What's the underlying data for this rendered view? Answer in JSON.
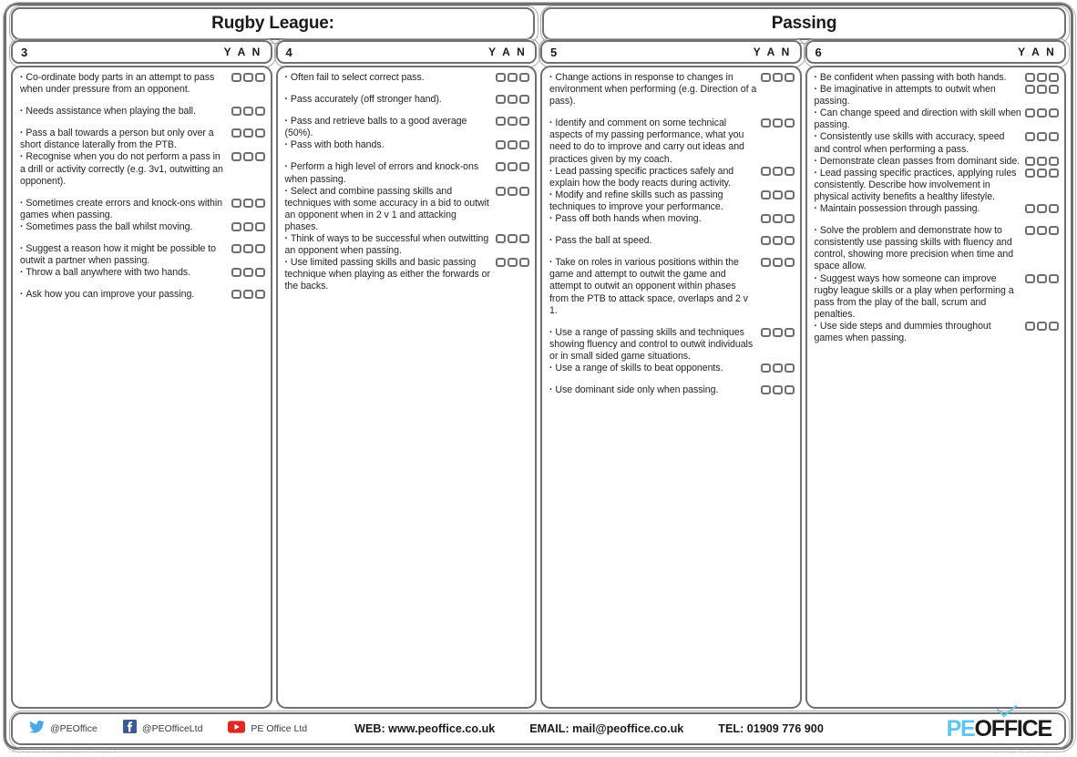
{
  "header": {
    "left_title": "Rugby League:",
    "right_title": "Passing"
  },
  "columns": [
    {
      "number": "3",
      "yan": "Y A N",
      "items": [
        {
          "text": "Co-ordinate body parts in an attempt to pass when under pressure from an opponent.",
          "boxes": 3,
          "gap_before": false
        },
        {
          "text": "Needs assistance when playing the ball.",
          "boxes": 3,
          "gap_before": true
        },
        {
          "text": "Pass a ball towards a person but only over a short distance laterally from the PTB.",
          "boxes": 3,
          "gap_before": true
        },
        {
          "text": "Recognise when you do not perform a pass in a drill or activity correctly (e.g. 3v1, outwitting an opponent).",
          "boxes": 3,
          "gap_before": false
        },
        {
          "text": "Sometimes create errors and knock-ons within games when passing.",
          "boxes": 3,
          "gap_before": true
        },
        {
          "text": "Sometimes pass the ball whilst moving.",
          "boxes": 3,
          "gap_before": false
        },
        {
          "text": "Suggest a reason how it might be possible to outwit a partner when passing.",
          "boxes": 3,
          "gap_before": true
        },
        {
          "text": "Throw a ball anywhere with two hands.",
          "boxes": 3,
          "gap_before": false
        },
        {
          "text": "Ask how you can improve your passing.",
          "boxes": 3,
          "gap_before": true
        }
      ]
    },
    {
      "number": "4",
      "yan": "Y A N",
      "items": [
        {
          "text": "Often fail to select correct pass.",
          "boxes": 3,
          "gap_before": false
        },
        {
          "text": "Pass accurately (off stronger hand).",
          "boxes": 3,
          "gap_before": true
        },
        {
          "text": "Pass and retrieve balls to a good average (50%).",
          "boxes": 3,
          "gap_before": true
        },
        {
          "text": "Pass with both hands.",
          "boxes": 3,
          "gap_before": false
        },
        {
          "text": "Perform a high level of errors and knock-ons when passing.",
          "boxes": 3,
          "gap_before": true
        },
        {
          "text": "Select and combine passing skills and techniques with some accuracy in a bid to outwit an opponent when in 2 v 1 and attacking phases.",
          "boxes": 3,
          "gap_before": false
        },
        {
          "text": "Think of ways to be successful when outwitting an opponent when passing.",
          "boxes": 3,
          "gap_before": false
        },
        {
          "text": "Use limited passing skills and basic passing technique when playing as either the forwards or the backs.",
          "boxes": 3,
          "gap_before": false
        }
      ]
    },
    {
      "number": "5",
      "yan": "Y A N",
      "items": [
        {
          "text": "Change actions in response to changes in environment when performing (e.g. Direction of a pass).",
          "boxes": 3,
          "gap_before": false
        },
        {
          "text": "Identify and comment on some technical aspects of my passing performance, what you need to do to improve and carry out ideas and practices given by my coach.",
          "boxes": 3,
          "gap_before": true
        },
        {
          "text": "Lead passing specific practices safely and explain how the body reacts during activity.",
          "boxes": 3,
          "gap_before": false
        },
        {
          "text": "Modify and refine skills such as passing techniques to improve your performance.",
          "boxes": 3,
          "gap_before": false
        },
        {
          "text": "Pass off both hands when moving.",
          "boxes": 3,
          "gap_before": false
        },
        {
          "text": "Pass the ball at speed.",
          "boxes": 3,
          "gap_before": true
        },
        {
          "text": "Take on roles in various positions within the game and attempt to outwit the game and attempt to outwit an opponent within phases from the PTB to attack space, overlaps and 2 v 1.",
          "boxes": 3,
          "gap_before": true
        },
        {
          "text": "Use a range of passing skills and techniques showing fluency and control to outwit individuals or in small sided game situations.",
          "boxes": 3,
          "gap_before": true
        },
        {
          "text": "Use a range of skills to beat opponents.",
          "boxes": 3,
          "gap_before": false
        },
        {
          "text": "Use dominant side only when passing.",
          "boxes": 3,
          "gap_before": true
        }
      ]
    },
    {
      "number": "6",
      "yan": "Y A N",
      "items": [
        {
          "text": "Be confident when passing with both hands.",
          "boxes": 3,
          "gap_before": false
        },
        {
          "text": "Be imaginative in attempts to outwit when passing.",
          "boxes": 3,
          "gap_before": false
        },
        {
          "text": "Can change speed and direction with skill when passing.",
          "boxes": 3,
          "gap_before": false
        },
        {
          "text": "Consistently use skills with accuracy, speed and control when performing a pass.",
          "boxes": 3,
          "gap_before": false
        },
        {
          "text": "Demonstrate clean passes from dominant side.",
          "boxes": 3,
          "gap_before": false
        },
        {
          "text": "Lead passing specific practices, applying rules consistently. Describe how involvement in physical activity benefits a healthy lifestyle.",
          "boxes": 3,
          "gap_before": false
        },
        {
          "text": "Maintain possession through passing.",
          "boxes": 3,
          "gap_before": false
        },
        {
          "text": "Solve the problem and demonstrate how to consistently use passing skills with fluency and control, showing more precision when time and space allow.",
          "boxes": 3,
          "gap_before": true
        },
        {
          "text": "Suggest ways how someone can improve rugby league skills or a play when performing a pass from the play of the ball, scrum and penalties.",
          "boxes": 3,
          "gap_before": false
        },
        {
          "text": "Use side steps and dummies throughout games when passing.",
          "boxes": 3,
          "gap_before": false
        }
      ]
    }
  ],
  "footer": {
    "social": [
      {
        "icon": "twitter-icon",
        "label": "@PEOffice",
        "color": "#48a8e8"
      },
      {
        "icon": "facebook-icon",
        "label": "@PEOfficeLtd",
        "color": "#3b5998"
      },
      {
        "icon": "youtube-icon",
        "label": "PE Office Ltd",
        "color": "#e02a20"
      }
    ],
    "web": "WEB: www.peoffice.co.uk",
    "email": "EMAIL: mail@peoffice.co.uk",
    "tel": "TEL: 01909 776 900",
    "logo_pe": "PE",
    "logo_office": "OFFICE",
    "logo_accent": "#5bc6f0"
  },
  "microtext": {
    "left": "PE Office Ltd - Assessment Sheet - Version 1.0",
    "right": "Copyright PE Office Ltd 2016 ©"
  }
}
